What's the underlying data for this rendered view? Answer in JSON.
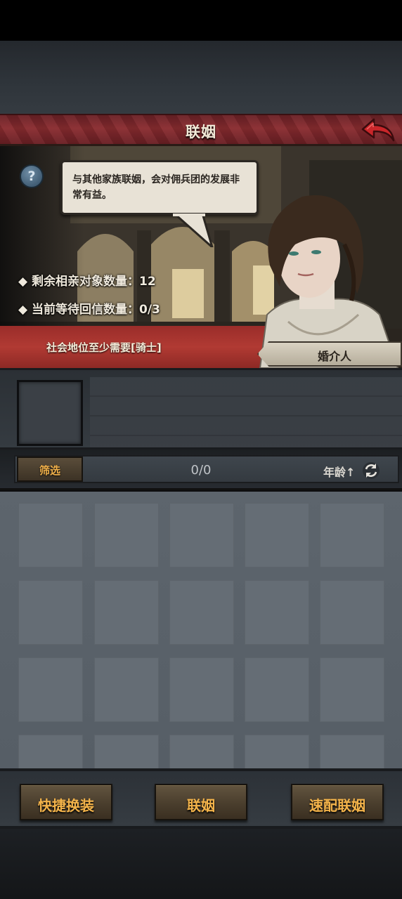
{
  "header": {
    "title": "联姻",
    "back_icon": "back-arrow-icon"
  },
  "scene": {
    "help_symbol": "?",
    "speech": "与其他家族联姻，会对佣兵团的发展非常有益。",
    "stats": [
      "◆ 剩余相亲对象数量：12",
      "◆ 当前等待回信数量：0/3"
    ],
    "requirement": "社会地位至少需要[骑士]",
    "npc_label": "婚介人"
  },
  "filter_bar": {
    "filter_label": "筛选",
    "count": "0/0",
    "sort_label": "年龄↑",
    "refresh_icon": "refresh-icon"
  },
  "actions": {
    "quick_equip": "快捷换装",
    "marry": "联姻",
    "quick_match": "速配联姻"
  },
  "colors": {
    "title_red": "#8a2c30",
    "button_gold_text": "#f3b34a",
    "panel_gray": "#5d656d"
  }
}
